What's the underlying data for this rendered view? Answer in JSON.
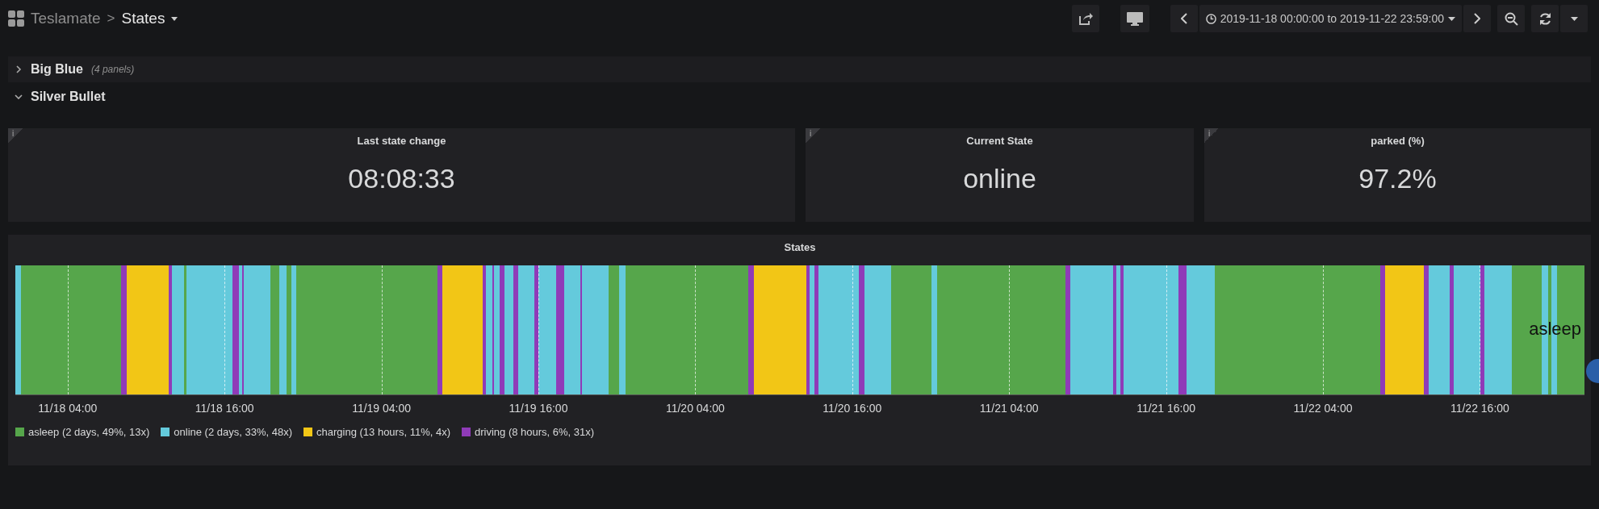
{
  "topbar": {
    "app": "Teslamate",
    "separator": ">",
    "dashboard": "States",
    "time_range": "2019-11-18 00:00:00 to 2019-11-22 23:59:00"
  },
  "rows": [
    {
      "title": "Big Blue",
      "note": "(4 panels)",
      "expanded": false
    },
    {
      "title": "Silver Bullet",
      "expanded": true
    }
  ],
  "stats": [
    {
      "info": "i",
      "title": "Last state change",
      "value": "08:08:33"
    },
    {
      "info": "i",
      "title": "Current State",
      "value": "online"
    },
    {
      "info": "i",
      "title": "parked (%)",
      "value": "97.2%"
    }
  ],
  "states_panel": {
    "title": "States",
    "hover_label": "asleep",
    "x_ticks": [
      "11/18 04:00",
      "11/18 16:00",
      "11/19 04:00",
      "11/19 16:00",
      "11/20 04:00",
      "11/20 16:00",
      "11/21 04:00",
      "11/21 16:00",
      "11/22 04:00",
      "11/22 16:00"
    ],
    "legend": [
      {
        "label": "asleep (2 days, 49%, 13x)",
        "color": "#56a64b"
      },
      {
        "label": "online (2 days, 33%, 48x)",
        "color": "#64cadc"
      },
      {
        "label": "charging (13 hours, 11%, 4x)",
        "color": "#f2c616"
      },
      {
        "label": "driving (8 hours, 6%, 31x)",
        "color": "#8f3bb8"
      }
    ]
  }
}
